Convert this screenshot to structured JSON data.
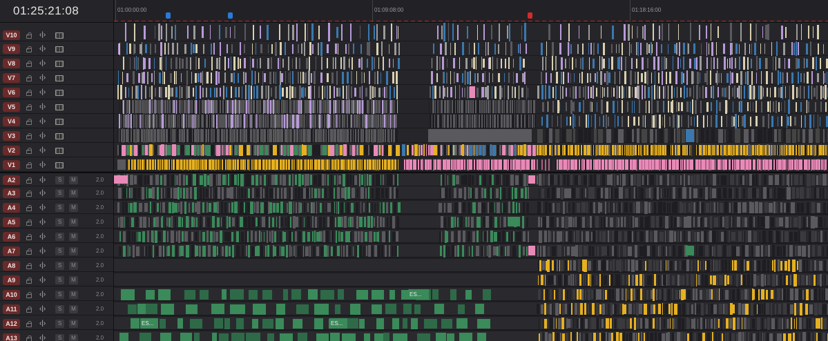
{
  "timecode": "01:25:21:08",
  "ruler": {
    "labels": [
      "01:00:00:00",
      "01:09:08:00",
      "01:18:16:00"
    ]
  },
  "colors": {
    "bg": "#1e1e22",
    "track_name_bg": "#6b2a2a",
    "marker_blue": "#2a7ad8",
    "marker_red": "#d42a2a",
    "clip_yellow": "#e6b020",
    "clip_pink": "#e88ab8",
    "clip_green": "#3a8a5a",
    "clip_gray": "#5a5a5e",
    "clip_blue": "#3a78b0",
    "clip_beige": "#d8d0b0",
    "clip_purple": "#b89ad8"
  },
  "video_tracks": [
    {
      "name": "V10"
    },
    {
      "name": "V9"
    },
    {
      "name": "V8"
    },
    {
      "name": "V7"
    },
    {
      "name": "V6"
    },
    {
      "name": "V5"
    },
    {
      "name": "V4"
    },
    {
      "name": "V3"
    },
    {
      "name": "V2"
    },
    {
      "name": "V1"
    }
  ],
  "audio_tracks": [
    {
      "name": "A2",
      "volume": "2.0"
    },
    {
      "name": "A3",
      "volume": "2.0"
    },
    {
      "name": "A4",
      "volume": "2.0"
    },
    {
      "name": "A5",
      "volume": "2.0"
    },
    {
      "name": "A6",
      "volume": "2.0"
    },
    {
      "name": "A7",
      "volume": "2.0"
    },
    {
      "name": "A8",
      "volume": "2.0"
    },
    {
      "name": "A9",
      "volume": "2.0"
    },
    {
      "name": "A10",
      "volume": "2.0"
    },
    {
      "name": "A11",
      "volume": "2.0"
    },
    {
      "name": "A12",
      "volume": "2.0"
    },
    {
      "name": "A13",
      "volume": "2.0"
    }
  ],
  "labels": {
    "solo": "S",
    "mute": "M",
    "auto_select": "‹|›"
  },
  "clip_texts": {
    "a10": "ES...",
    "a12_1": "ES...",
    "a12_2": "ES..."
  }
}
